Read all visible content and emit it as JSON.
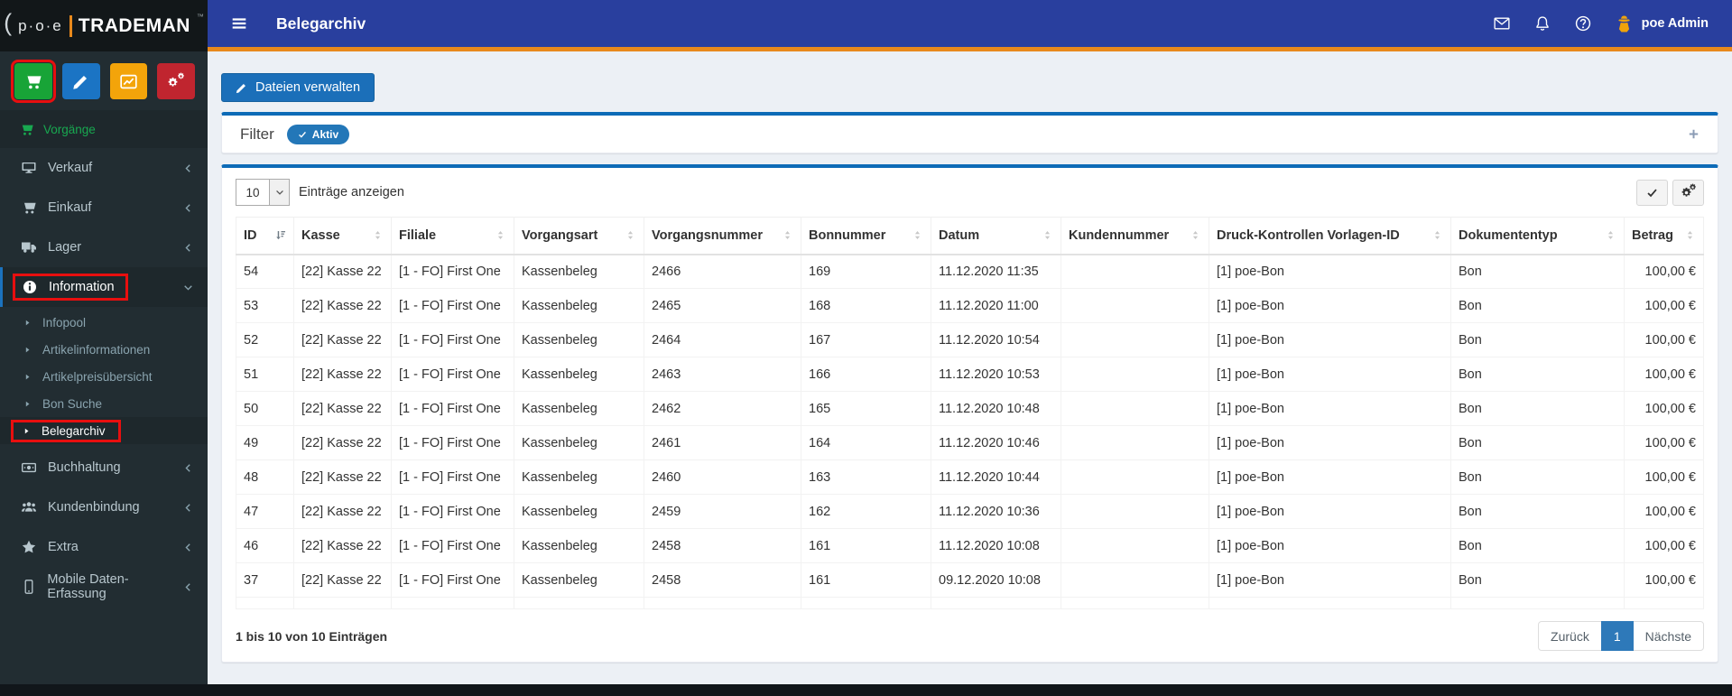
{
  "brand": {
    "paren": "(",
    "poe": "p·o·e",
    "name": "TRADEMAN",
    "mark": "™"
  },
  "topbar": {
    "title": "Belegarchiv",
    "menu_icon": "bars-icon",
    "action_icons": [
      "mail-icon",
      "bell-icon",
      "help-icon"
    ],
    "user_icon": "user-secret-icon",
    "user_name": "poe Admin",
    "bg_color": "#293f9e",
    "accent_color": "#e8891c"
  },
  "sidebar": {
    "shortcut_buttons": [
      {
        "name": "shortcut-cart-button",
        "icon": "cart-icon",
        "color": "#18a437",
        "annotated": true
      },
      {
        "name": "shortcut-edit-button",
        "icon": "pencil-icon",
        "color": "#1b74c4"
      },
      {
        "name": "shortcut-chart-button",
        "icon": "chart-icon",
        "color": "#f3a40a"
      },
      {
        "name": "shortcut-settings-button",
        "icon": "cogs-icon",
        "color": "#c0252f"
      }
    ],
    "section_header": {
      "label": "Vorgänge",
      "icon": "cart-icon",
      "color": "#18a850"
    },
    "items": [
      {
        "label": "Verkauf",
        "icon": "desktop-icon",
        "chevron": "left"
      },
      {
        "label": "Einkauf",
        "icon": "cart-icon",
        "chevron": "left"
      },
      {
        "label": "Lager",
        "icon": "truck-icon",
        "chevron": "left"
      },
      {
        "label": "Information",
        "icon": "info-icon",
        "chevron": "down",
        "active": true,
        "annotated": true,
        "children": [
          {
            "label": "Infopool"
          },
          {
            "label": "Artikelinformationen"
          },
          {
            "label": "Artikelpreisübersicht"
          },
          {
            "label": "Bon Suche"
          },
          {
            "label": "Belegarchiv",
            "active": true,
            "annotated": true
          }
        ]
      },
      {
        "label": "Buchhaltung",
        "icon": "money-icon",
        "chevron": "left"
      },
      {
        "label": "Kundenbindung",
        "icon": "users-icon",
        "chevron": "left"
      },
      {
        "label": "Extra",
        "icon": "star-icon",
        "chevron": "left"
      },
      {
        "label": "Mobile Daten-Erfassung",
        "icon": "mobile-icon",
        "chevron": "left"
      }
    ]
  },
  "main": {
    "manage_files_button": {
      "label": "Dateien verwalten",
      "icon": "pencil-icon"
    },
    "filter": {
      "label": "Filter",
      "badge": "Aktiv",
      "badge_icon": "check-icon",
      "expand_icon": "plus-icon"
    },
    "table_controls": {
      "page_size": "10",
      "label": "Einträge anzeigen",
      "select_icon": "chevron-down-icon",
      "buttons": [
        {
          "name": "select-visible-button",
          "icon": "check-icon"
        },
        {
          "name": "column-settings-button",
          "icon": "cogs-icon"
        }
      ]
    },
    "table": {
      "columns": [
        {
          "label": "ID",
          "sort": "desc"
        },
        {
          "label": "Kasse",
          "sort": "both"
        },
        {
          "label": "Filiale",
          "sort": "both"
        },
        {
          "label": "Vorgangsart",
          "sort": "both"
        },
        {
          "label": "Vorgangsnummer",
          "sort": "both"
        },
        {
          "label": "Bonnummer",
          "sort": "both"
        },
        {
          "label": "Datum",
          "sort": "both"
        },
        {
          "label": "Kundennummer",
          "sort": "both"
        },
        {
          "label": "Druck-Kontrollen Vorlagen-ID",
          "sort": "both"
        },
        {
          "label": "Dokumententyp",
          "sort": "both"
        },
        {
          "label": "Betrag",
          "sort": "both"
        }
      ],
      "rows": [
        [
          "54",
          "[22] Kasse 22",
          "[1 - FO] First One",
          "Kassenbeleg",
          "2466",
          "169",
          "11.12.2020 11:35",
          "",
          "[1] poe-Bon",
          "Bon",
          "100,00 €"
        ],
        [
          "53",
          "[22] Kasse 22",
          "[1 - FO] First One",
          "Kassenbeleg",
          "2465",
          "168",
          "11.12.2020 11:00",
          "",
          "[1] poe-Bon",
          "Bon",
          "100,00 €"
        ],
        [
          "52",
          "[22] Kasse 22",
          "[1 - FO] First One",
          "Kassenbeleg",
          "2464",
          "167",
          "11.12.2020 10:54",
          "",
          "[1] poe-Bon",
          "Bon",
          "100,00 €"
        ],
        [
          "51",
          "[22] Kasse 22",
          "[1 - FO] First One",
          "Kassenbeleg",
          "2463",
          "166",
          "11.12.2020 10:53",
          "",
          "[1] poe-Bon",
          "Bon",
          "100,00 €"
        ],
        [
          "50",
          "[22] Kasse 22",
          "[1 - FO] First One",
          "Kassenbeleg",
          "2462",
          "165",
          "11.12.2020 10:48",
          "",
          "[1] poe-Bon",
          "Bon",
          "100,00 €"
        ],
        [
          "49",
          "[22] Kasse 22",
          "[1 - FO] First One",
          "Kassenbeleg",
          "2461",
          "164",
          "11.12.2020 10:46",
          "",
          "[1] poe-Bon",
          "Bon",
          "100,00 €"
        ],
        [
          "48",
          "[22] Kasse 22",
          "[1 - FO] First One",
          "Kassenbeleg",
          "2460",
          "163",
          "11.12.2020 10:44",
          "",
          "[1] poe-Bon",
          "Bon",
          "100,00 €"
        ],
        [
          "47",
          "[22] Kasse 22",
          "[1 - FO] First One",
          "Kassenbeleg",
          "2459",
          "162",
          "11.12.2020 10:36",
          "",
          "[1] poe-Bon",
          "Bon",
          "100,00 €"
        ],
        [
          "46",
          "[22] Kasse 22",
          "[1 - FO] First One",
          "Kassenbeleg",
          "2458",
          "161",
          "11.12.2020 10:08",
          "",
          "[1] poe-Bon",
          "Bon",
          "100,00 €"
        ],
        [
          "37",
          "[22] Kasse 22",
          "[1 - FO] First One",
          "Kassenbeleg",
          "2458",
          "161",
          "09.12.2020 10:08",
          "",
          "[1] poe-Bon",
          "Bon",
          "100,00 €"
        ]
      ]
    },
    "summary": "1 bis 10 von 10 Einträgen",
    "pagination": {
      "prev": "Zurück",
      "current": "1",
      "next": "Nächste"
    }
  },
  "colors": {
    "panel_top_border": "#0d6bb7",
    "badge_blue": "#2377b8",
    "pagination_active": "#2e79b9",
    "annotation_red": "#e80f0f",
    "sidebar_bg": "#222d32",
    "content_bg": "#ecf0f5"
  }
}
